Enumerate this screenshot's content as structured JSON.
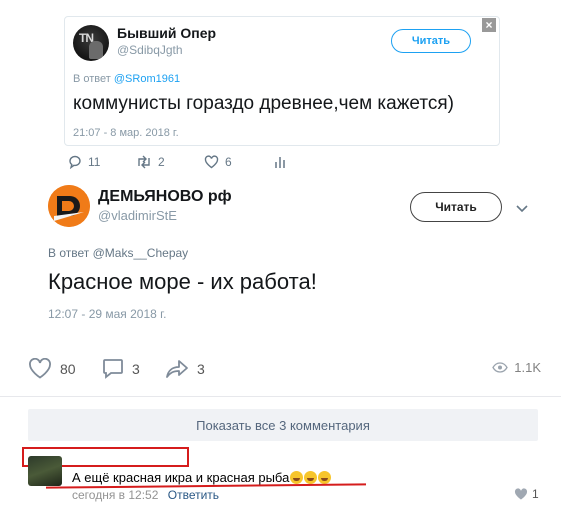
{
  "tweet1": {
    "name": "Бывший Опер",
    "handle": "@SdibqJgth",
    "follow_label": "Читать",
    "reply_prefix": "В ответ",
    "reply_to": "@SRom1961",
    "text": "коммунисты гораздо древнее,чем кажется)",
    "time": "21:07 - 8 мар. 2018 г.",
    "close_label": "×",
    "replies": "11",
    "retweets": "2",
    "likes": "6"
  },
  "tweet2": {
    "name": "ДЕМЬЯНОВО рф",
    "handle": "@vladimirStE",
    "follow_label": "Читать",
    "reply_prefix": "В ответ",
    "reply_to": "@Maks__Chepay",
    "text": "Красное море - их работа!",
    "time": "12:07 - 29 мая 2018 г."
  },
  "post_actions": {
    "likes": "80",
    "comments": "3",
    "shares": "3",
    "views": "1.1K"
  },
  "comments": {
    "show_all_label": "Показать все 3 комментария",
    "items": [
      {
        "text": "А ещё красная икра и красная рыба",
        "time": "сегодня в 12:52",
        "reply_label": "Ответить",
        "likes": "1"
      }
    ]
  },
  "colors": {
    "twitter_blue": "#1da1f2",
    "highlight_red": "#d51c1c",
    "brand_orange": "#f07b18"
  }
}
